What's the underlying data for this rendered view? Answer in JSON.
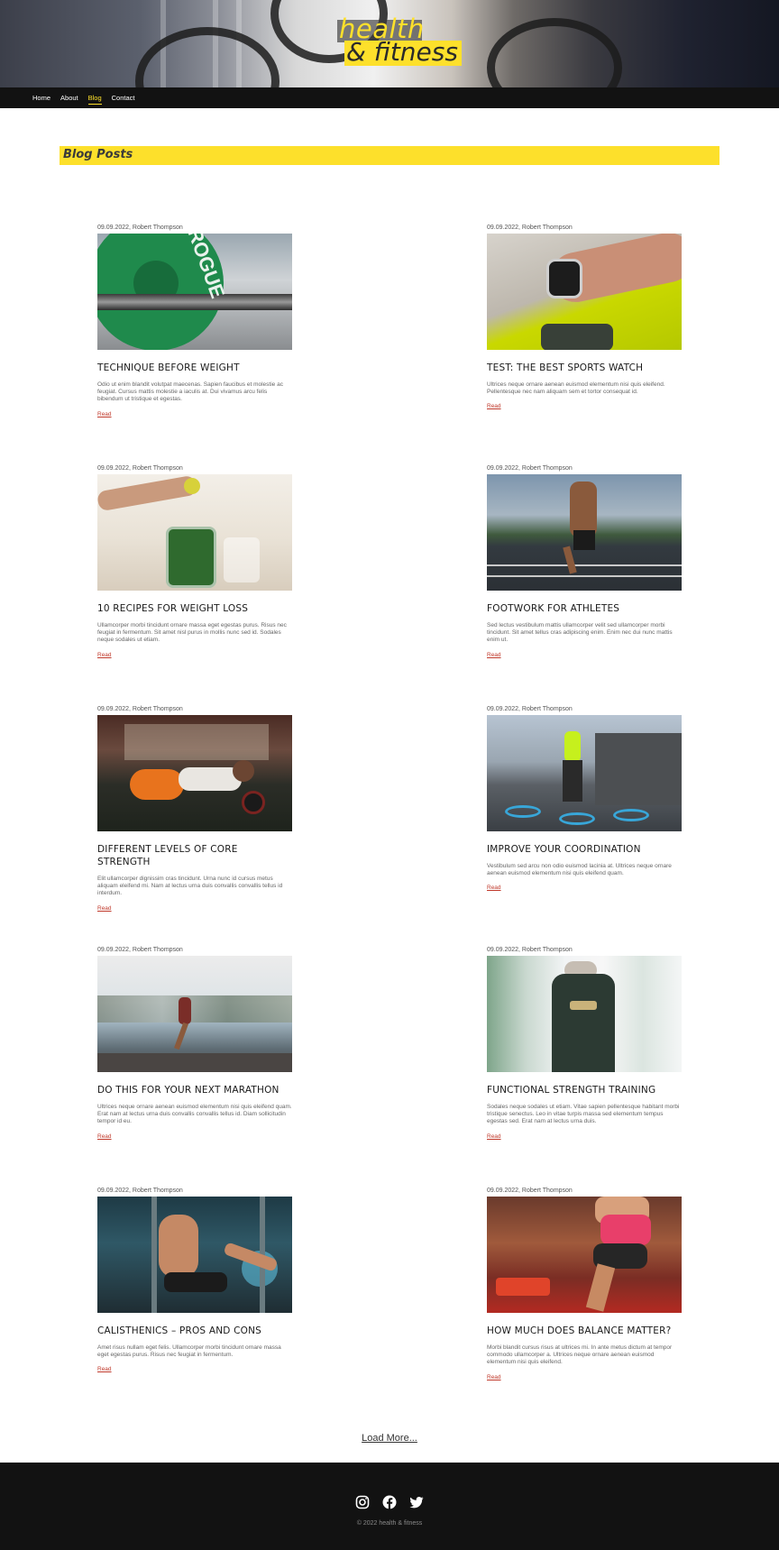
{
  "brand": {
    "line1": "health",
    "line2": "& fitness"
  },
  "nav": [
    {
      "label": "Home",
      "active": false
    },
    {
      "label": "About",
      "active": false
    },
    {
      "label": "Blog",
      "active": true
    },
    {
      "label": "Contact",
      "active": false
    }
  ],
  "section_title": "Blog Posts",
  "posts": [
    {
      "meta": "09.09.2022, Robert Thompson",
      "title": "TECHNIQUE BEFORE WEIGHT",
      "excerpt": "Odio ut enim blandit volutpat maecenas. Sapien faucibus et molestie ac feugiat. Cursus mattis molestie a iaculis at. Dui vivamus arcu felis bibendum ut tristique et egestas.",
      "read": "Read"
    },
    {
      "meta": "09.09.2022, Robert Thompson",
      "title": "TEST: THE BEST SPORTS WATCH",
      "excerpt": "Ultrices neque ornare aenean euismod elementum nisi quis eleifend. Pellentesque nec nam aliquam sem et tortor consequat id.",
      "read": "Read"
    },
    {
      "meta": "09.09.2022, Robert Thompson",
      "title": "10 RECIPES FOR WEIGHT LOSS",
      "excerpt": "Ullamcorper morbi tincidunt ornare massa eget egestas purus. Risus nec feugiat in fermentum. Sit amet nisl purus in mollis nunc sed id. Sodales neque sodales ut etiam.",
      "read": "Read"
    },
    {
      "meta": "09.09.2022, Robert Thompson",
      "title": "FOOTWORK FOR ATHLETES",
      "excerpt": "Sed lectus vestibulum mattis ullamcorper velit sed ullamcorper morbi tincidunt. Sit amet tellus cras adipiscing enim. Enim nec dui nunc mattis enim ut.",
      "read": "Read"
    },
    {
      "meta": "09.09.2022, Robert Thompson",
      "title": "DIFFERENT LEVELS OF CORE STRENGTH",
      "excerpt": "Elit ullamcorper dignissim cras tincidunt. Urna nunc id cursus metus aliquam eleifend mi. Nam at lectus urna duis convallis convallis tellus id interdum.",
      "read": "Read"
    },
    {
      "meta": "09.09.2022, Robert Thompson",
      "title": "IMPROVE YOUR COORDINATION",
      "excerpt": "Vestibulum sed arcu non odio euismod lacinia at. Ultrices neque ornare aenean euismod elementum nisi quis eleifend quam.",
      "read": "Read"
    },
    {
      "meta": "09.09.2022, Robert Thompson",
      "title": "DO THIS FOR YOUR NEXT MARATHON",
      "excerpt": "Ultrices neque ornare aenean euismod elementum nisi quis eleifend quam. Erat nam at lectus urna duis convallis convallis tellus id. Diam sollicitudin tempor id eu.",
      "read": "Read"
    },
    {
      "meta": "09.09.2022, Robert Thompson",
      "title": "FUNCTIONAL STRENGTH TRAINING",
      "excerpt": "Sodales neque sodales ut etiam. Vitae sapien pellentesque habitant morbi tristique senectus. Leo in vitae turpis massa sed elementum tempus egestas sed. Erat nam at lectus urna duis.",
      "read": "Read"
    },
    {
      "meta": "09.09.2022, Robert Thompson",
      "title": "CALISTHENICS – PROS AND CONS",
      "excerpt": "Amet risus nullam eget felis. Ullamcorper morbi tincidunt ornare massa eget egestas purus. Risus nec feugiat in fermentum.",
      "read": "Read"
    },
    {
      "meta": "09.09.2022, Robert Thompson",
      "title": "HOW MUCH DOES BALANCE MATTER?",
      "excerpt": "Morbi blandit cursus risus at ultrices mi. In ante metus dictum at tempor commodo ullamcorper a. Ultrices neque ornare aenean euismod elementum nisi quis eleifend.",
      "read": "Read"
    }
  ],
  "load_more": "Load More...",
  "footer": {
    "copyright": "© 2022 health & fitness"
  },
  "colors": {
    "accent": "#fde02b",
    "dark": "#121212",
    "link": "#c0392b"
  }
}
